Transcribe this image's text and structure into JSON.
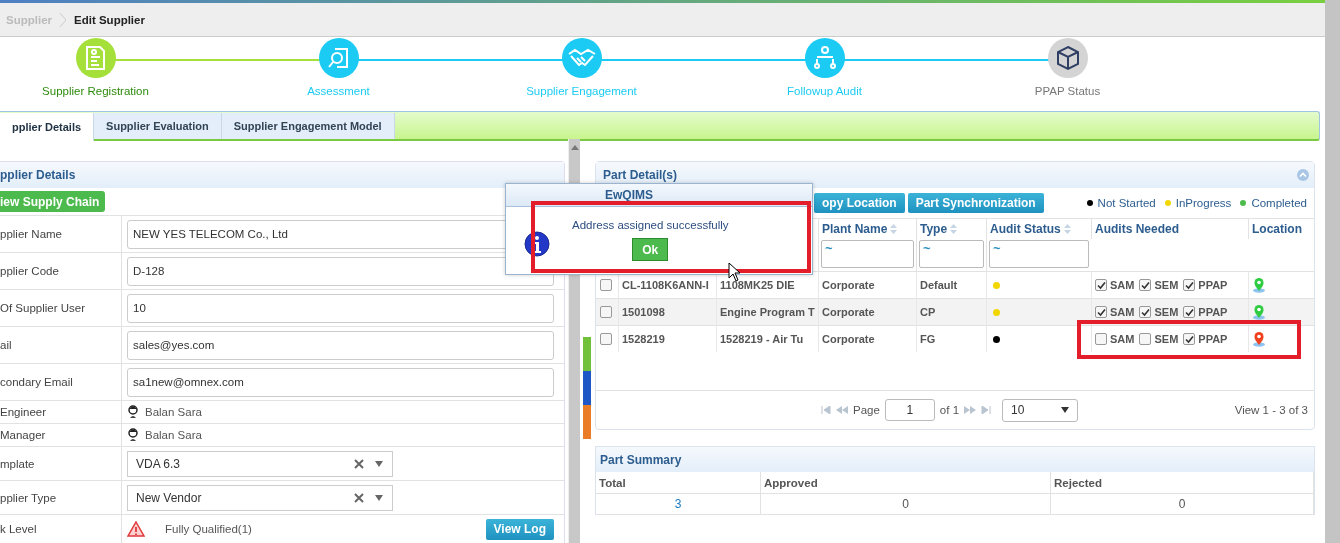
{
  "breadcrumb": [
    {
      "label": "Supplier",
      "current": false
    },
    {
      "label": "Edit Supplier",
      "current": true
    }
  ],
  "steps": [
    {
      "label": "Supplier Registration",
      "kind": "done"
    },
    {
      "label": "Assessment",
      "kind": "active"
    },
    {
      "label": "Supplier Engagement",
      "kind": "active"
    },
    {
      "label": "Followup Audit",
      "kind": "active"
    },
    {
      "label": "PPAP Status",
      "kind": "pending"
    }
  ],
  "tabs": [
    {
      "label": "pplier Details",
      "selected": true
    },
    {
      "label": "Supplier Evaluation",
      "selected": false
    },
    {
      "label": "Supplier Engagement Model",
      "selected": false
    }
  ],
  "supplier_panel": {
    "title": "pplier Details",
    "button": "iew Supply Chain",
    "fields": [
      {
        "kind": "input",
        "label": "pplier Name",
        "value": "NEW YES TELECOM Co., Ltd"
      },
      {
        "kind": "input",
        "label": "pplier Code",
        "value": "D-128"
      },
      {
        "kind": "input",
        "label": "Of Supplier User",
        "value": "10"
      },
      {
        "kind": "input",
        "label": "ail",
        "value": "sales@yes.com"
      },
      {
        "kind": "input",
        "label": "condary Email",
        "value": "sa1new@omnex.com"
      },
      {
        "kind": "person",
        "label": "Engineer",
        "value": "Balan Sara"
      },
      {
        "kind": "person",
        "label": "Manager",
        "value": "Balan Sara"
      },
      {
        "kind": "select",
        "label": "mplate",
        "value": "VDA 6.3"
      },
      {
        "kind": "select",
        "label": "pplier Type",
        "value": "New Vendor"
      },
      {
        "kind": "risk",
        "label": "k Level",
        "value": "Fully Qualified(1)",
        "button": "View Log"
      }
    ]
  },
  "part_panel": {
    "title": "Part Detail(s)",
    "buttons": [
      "opy Location",
      "Part Synchronization"
    ],
    "legend": [
      {
        "label": "Not Started",
        "color": "#000000"
      },
      {
        "label": "InProgress",
        "color": "#f2d600"
      },
      {
        "label": "Completed",
        "color": "#4cbb4c"
      }
    ],
    "columns": [
      {
        "label": "Plant Name",
        "sortable": true
      },
      {
        "label": "Type",
        "sortable": true
      },
      {
        "label": "Audit Status",
        "sortable": true
      },
      {
        "label": "Audits Needed",
        "sortable": false
      },
      {
        "label": "Location",
        "sortable": false
      }
    ],
    "filters": [
      "~",
      "~",
      "~"
    ],
    "rows": [
      {
        "selected": false,
        "part_no": "CL-1108K6ANN-I",
        "description": "1108MK25 DIE",
        "plant": "Corporate",
        "type": "Default",
        "audit_status": {
          "color": "#f2d600"
        },
        "audits": [
          {
            "label": "SAM",
            "checked": true
          },
          {
            "label": "SEM",
            "checked": true
          },
          {
            "label": "PPAP",
            "checked": true
          }
        ],
        "location": {
          "color": "#2ecc40"
        }
      },
      {
        "selected": false,
        "part_no": "1501098",
        "description": "Engine Program T",
        "plant": "Corporate",
        "type": "CP",
        "audit_status": {
          "color": "#f2d600"
        },
        "audits": [
          {
            "label": "SAM",
            "checked": true
          },
          {
            "label": "SEM",
            "checked": true
          },
          {
            "label": "PPAP",
            "checked": true
          }
        ],
        "location": {
          "color": "#2ecc40"
        }
      },
      {
        "selected": false,
        "part_no": "1528219",
        "description": "1528219 - Air Tu",
        "plant": "Corporate",
        "type": "FG",
        "audit_status": {
          "color": "#000000"
        },
        "audits": [
          {
            "label": "SAM",
            "checked": false
          },
          {
            "label": "SEM",
            "checked": false
          },
          {
            "label": "PPAP",
            "checked": true
          }
        ],
        "location": {
          "color": "#f0401e"
        }
      }
    ],
    "pager": {
      "page_label": "Page",
      "page": "1",
      "of": "of 1",
      "page_size": "10",
      "view": "View 1 - 3 of 3"
    }
  },
  "summary": {
    "title": "Part Summary",
    "columns": [
      "Total",
      "Approved",
      "Rejected"
    ],
    "values": [
      "3",
      "0",
      "0"
    ]
  },
  "dialog": {
    "title": "EwQIMS",
    "message": "Address assigned successfully",
    "button": "Ok"
  }
}
